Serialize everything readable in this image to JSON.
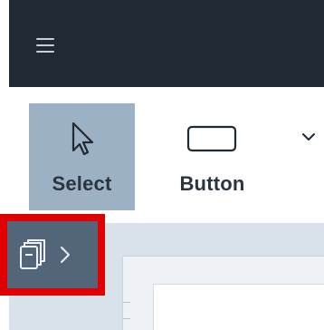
{
  "header": {
    "menu_icon": "hamburger-menu-icon",
    "background": "#1f2a35"
  },
  "toolbar": {
    "tools": [
      {
        "label": "Select",
        "icon": "cursor-arrow-icon",
        "active": true
      },
      {
        "label": "Button",
        "icon": "rectangle-icon",
        "active": false
      }
    ],
    "more_icon": "chevron-down-icon",
    "active_color": "#9db1c5"
  },
  "pages_panel": {
    "icon": "pages-stack-icon",
    "expand_icon": "chevron-right-icon",
    "background": "#526579",
    "highlight_color": "#e00000"
  },
  "canvas": {
    "background": "#d9e2eb"
  }
}
